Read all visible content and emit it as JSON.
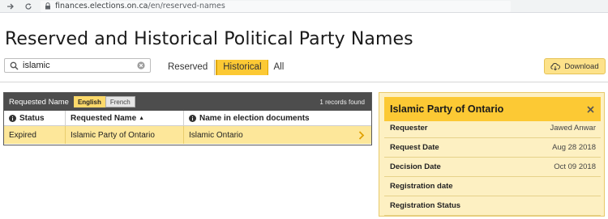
{
  "browser": {
    "url_host": "finances.elections.on.ca",
    "url_path": "/en/reserved-names"
  },
  "page": {
    "title": "Reserved and Historical Political Party Names"
  },
  "search": {
    "value": "islamic"
  },
  "tabs": [
    {
      "label": "Reserved",
      "active": false
    },
    {
      "label": "Historical",
      "active": true
    },
    {
      "label": "All",
      "active": false
    }
  ],
  "toolbar": {
    "download_label": "Download"
  },
  "table": {
    "header_label": "Requested Name",
    "languages": [
      {
        "label": "English",
        "active": true
      },
      {
        "label": "French",
        "active": false
      }
    ],
    "records_text": "1 records found",
    "columns": [
      "Status",
      "Requested Name",
      "Name in election documents"
    ],
    "rows": [
      {
        "status": "Expired",
        "requested_name": "Islamic Party of Ontario",
        "election_name": "Islamic Ontario"
      }
    ]
  },
  "detail": {
    "title": "Islamic Party of Ontario",
    "fields": [
      {
        "label": "Requester",
        "value": "Jawed Anwar"
      },
      {
        "label": "Request Date",
        "value": "Aug 28 2018"
      },
      {
        "label": "Decision Date",
        "value": "Oct 09 2018"
      },
      {
        "label": "Registration date",
        "value": ""
      },
      {
        "label": "Registration Status",
        "value": ""
      }
    ]
  },
  "colors": {
    "accent": "#fcc934",
    "row_highlight": "#fde79a",
    "panel_bg": "#fdf0c2",
    "header_bar": "#4d4d4d"
  },
  "icons": {
    "back": "arrow-right-icon",
    "reload": "reload-icon",
    "lock": "lock-icon",
    "search": "search-icon",
    "clear": "clear-icon",
    "download": "cloud-download-icon",
    "info": "info-icon",
    "sort": "sort-up-icon",
    "chevron": "chevron-right-icon",
    "close": "close-icon"
  }
}
